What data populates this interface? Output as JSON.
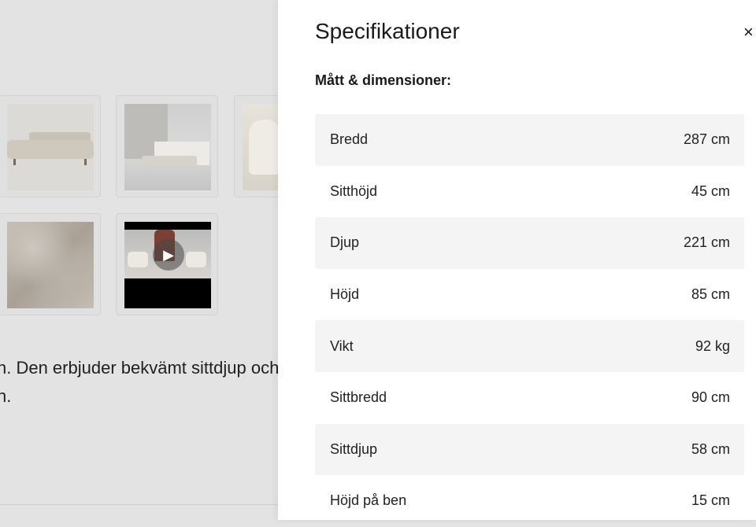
{
  "background": {
    "thumbnails": [
      {
        "name": "sofa-side-image",
        "kind": "sofa"
      },
      {
        "name": "room-scene-image",
        "kind": "room"
      },
      {
        "name": "chair-scene-image",
        "kind": "room2"
      },
      {
        "name": "fabric-image",
        "kind": "fabric"
      },
      {
        "name": "video-thumbnail",
        "kind": "video",
        "icon": "play-icon"
      }
    ],
    "description_line1": "n. Den erbjuder bekvämt sittdjup och",
    "description_line2": "n."
  },
  "drawer": {
    "title": "Specifikationer",
    "close_label": "×",
    "section_label": "Mått & dimensioner:",
    "rows": [
      {
        "label": "Bredd",
        "value": "287 cm"
      },
      {
        "label": "Sitthöjd",
        "value": "45 cm"
      },
      {
        "label": "Djup",
        "value": "221 cm"
      },
      {
        "label": "Höjd",
        "value": "85 cm"
      },
      {
        "label": "Vikt",
        "value": "92 kg"
      },
      {
        "label": "Sittbredd",
        "value": "90 cm"
      },
      {
        "label": "Sittdjup",
        "value": "58 cm"
      },
      {
        "label": "Höjd på ben",
        "value": "15 cm"
      }
    ]
  },
  "colors": {
    "page_background": "#e3e3e3",
    "drawer_background": "#ffffff",
    "row_shade": "#f4f4f4"
  }
}
